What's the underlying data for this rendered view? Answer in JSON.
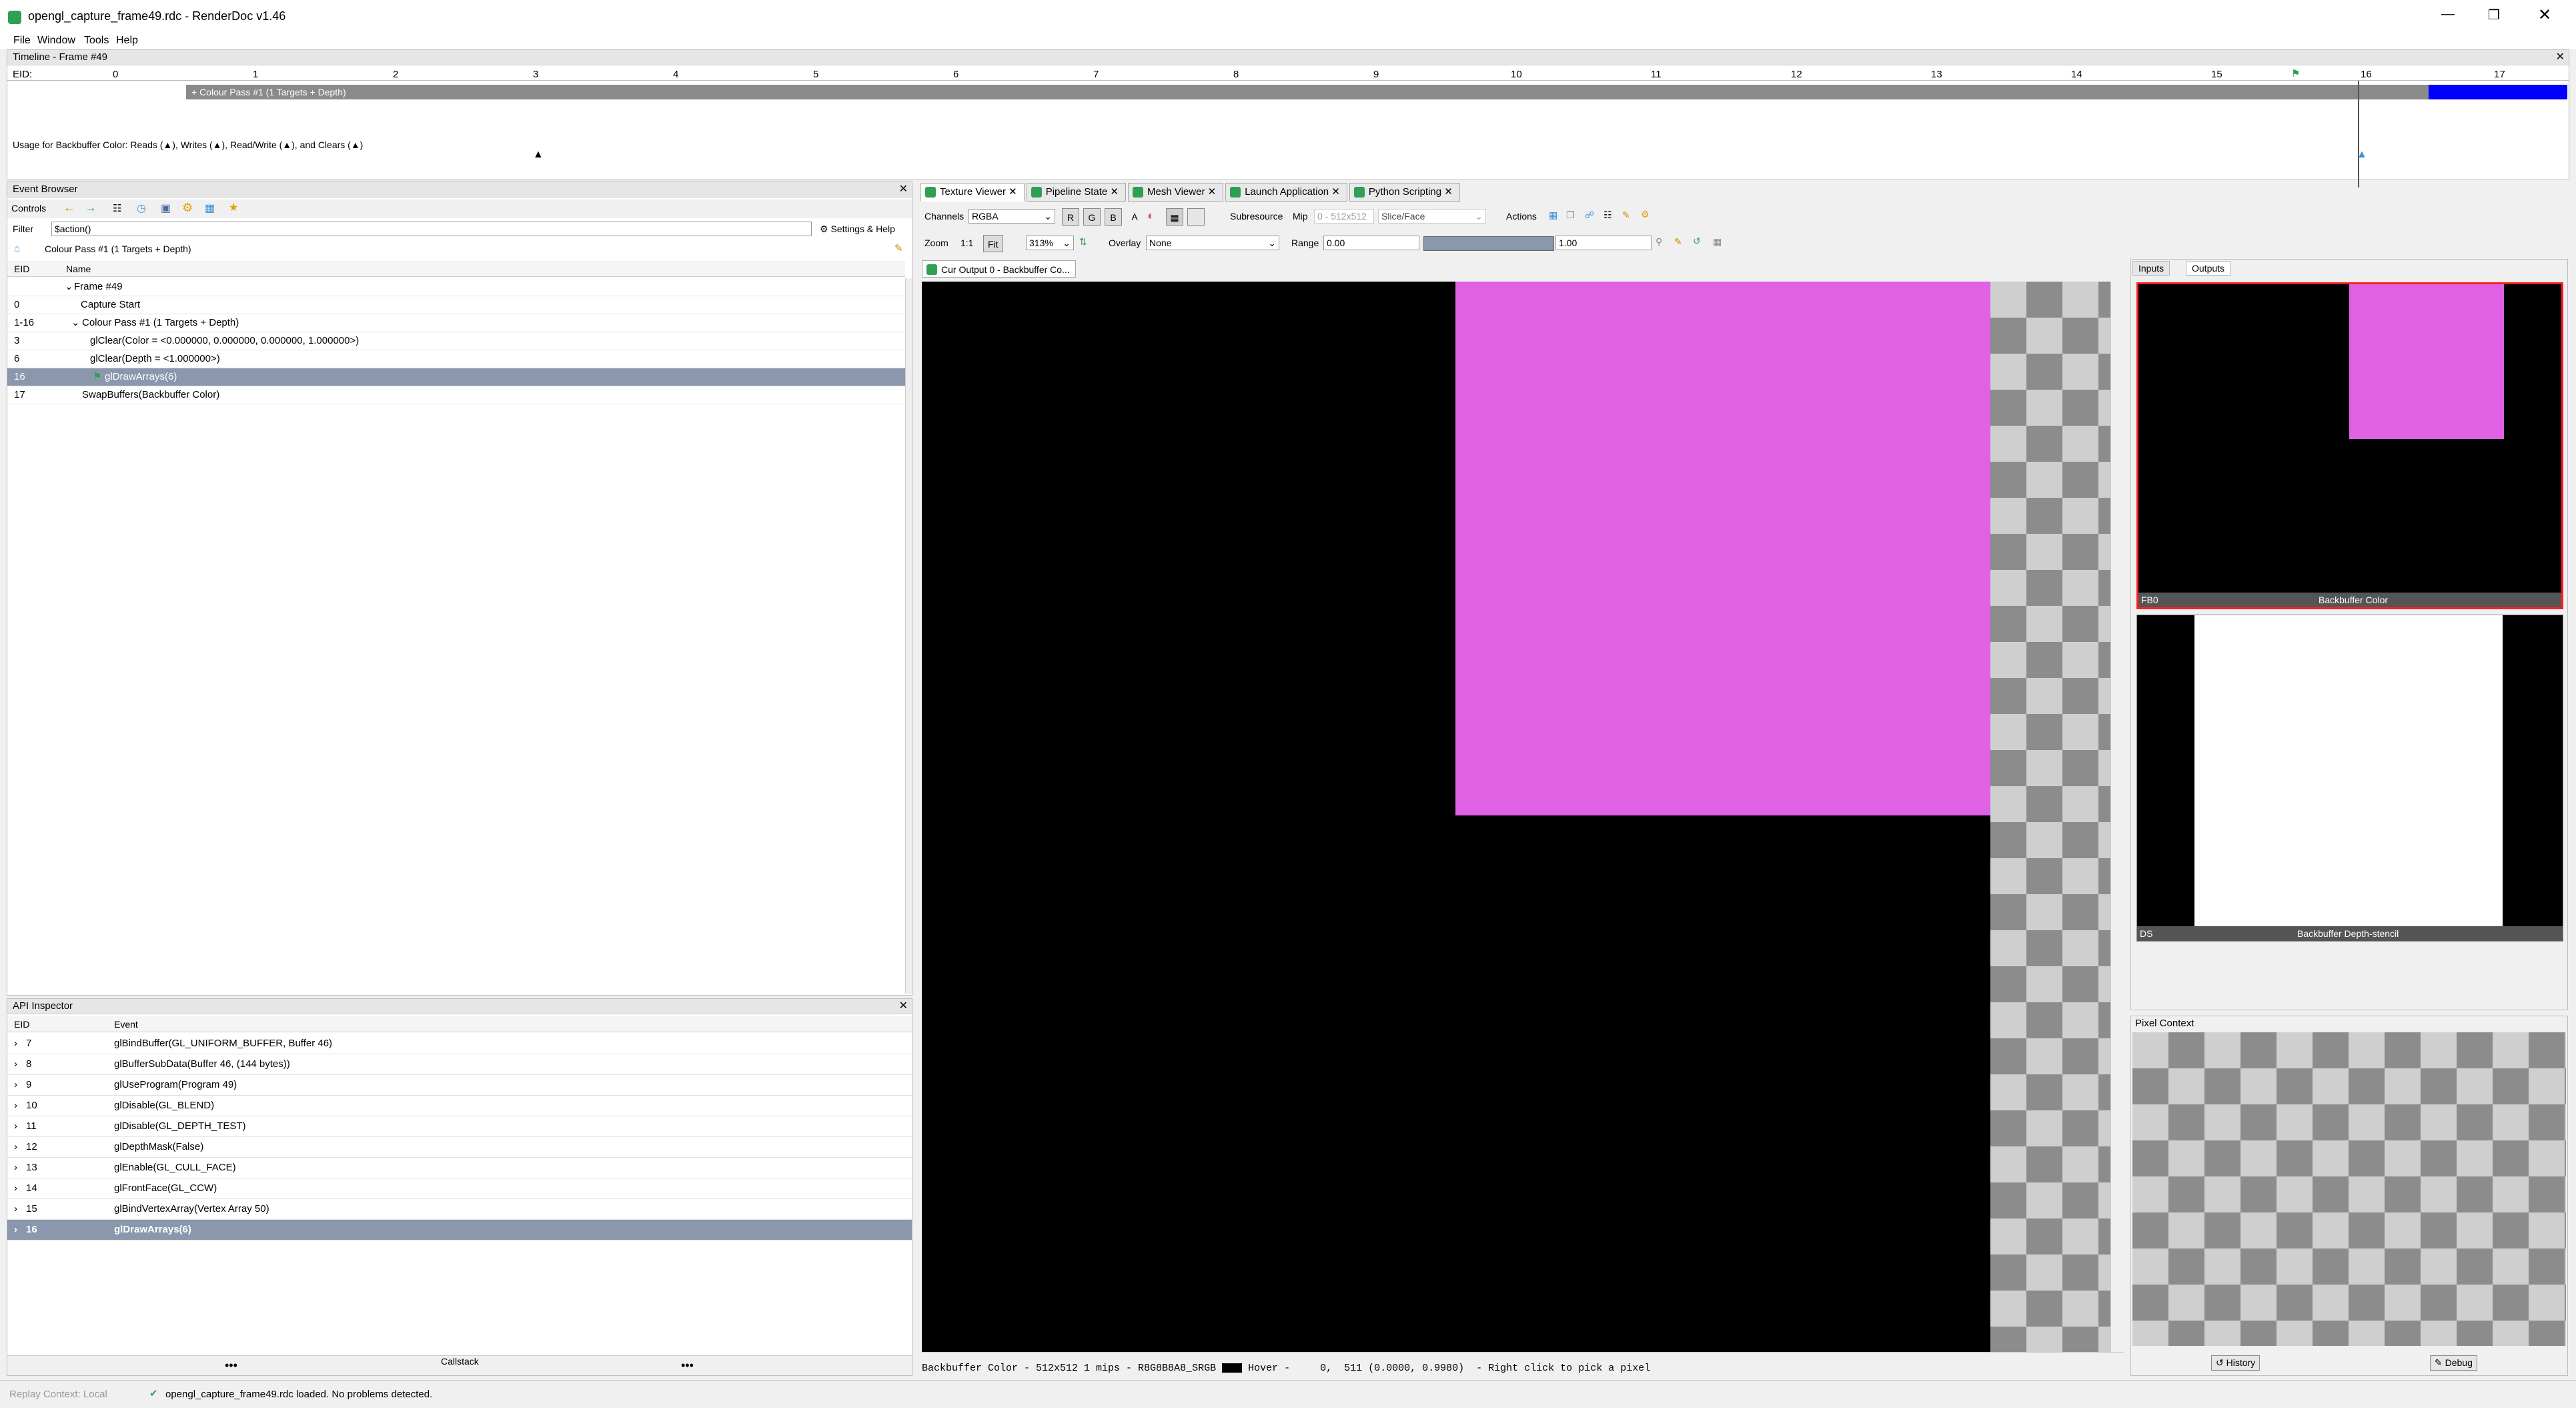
{
  "window": {
    "title": "opengl_capture_frame49.rdc - RenderDoc v1.46"
  },
  "menu": [
    "File",
    "Window",
    "Tools",
    "Help"
  ],
  "timeline": {
    "title": "Timeline - Frame #49",
    "eid_label": "EID:",
    "ticks": [
      "0",
      "1",
      "2",
      "3",
      "4",
      "5",
      "6",
      "7",
      "8",
      "9",
      "10",
      "11",
      "12",
      "13",
      "14",
      "15",
      "16",
      "17"
    ],
    "pass_label": "+ Colour Pass #1 (1 Targets + Depth)",
    "usage_text": "Usage for Backbuffer Color: Reads (▲), Writes (▲), Read/Write (▲), and Clears (▲)"
  },
  "event_browser": {
    "title": "Event Browser",
    "controls_label": "Controls",
    "filter_label": "Filter",
    "filter_value": "$action()",
    "settings_label": "Settings & Help",
    "breadcrumb": "Colour Pass #1 (1 Targets + Depth)",
    "col_eid": "EID",
    "col_name": "Name",
    "rows": [
      {
        "eid": "",
        "name": "Frame #49"
      },
      {
        "eid": "0",
        "name": "Capture Start"
      },
      {
        "eid": "1-16",
        "name": "Colour Pass #1 (1 Targets + Depth)"
      },
      {
        "eid": "3",
        "name": "glClear(Color = <0.000000, 0.000000, 0.000000, 1.000000>)"
      },
      {
        "eid": "6",
        "name": "glClear(Depth = <1.000000>)"
      },
      {
        "eid": "16",
        "name": "glDrawArrays(6)"
      },
      {
        "eid": "17",
        "name": "SwapBuffers(Backbuffer Color)"
      }
    ]
  },
  "api_inspector": {
    "title": "API Inspector",
    "col_eid": "EID",
    "col_event": "Event",
    "rows": [
      {
        "eid": "7",
        "event": "glBindBuffer(GL_UNIFORM_BUFFER, Buffer 46)"
      },
      {
        "eid": "8",
        "event": "glBufferSubData(Buffer 46, (144 bytes))"
      },
      {
        "eid": "9",
        "event": "glUseProgram(Program 49)"
      },
      {
        "eid": "10",
        "event": "glDisable(GL_BLEND)"
      },
      {
        "eid": "11",
        "event": "glDisable(GL_DEPTH_TEST)"
      },
      {
        "eid": "12",
        "event": "glDepthMask(False)"
      },
      {
        "eid": "13",
        "event": "glEnable(GL_CULL_FACE)"
      },
      {
        "eid": "14",
        "event": "glFrontFace(GL_CCW)"
      },
      {
        "eid": "15",
        "event": "glBindVertexArray(Vertex Array 50)"
      },
      {
        "eid": "16",
        "event": "glDrawArrays(6)"
      }
    ],
    "callstack_label": "Callstack"
  },
  "tabs": [
    "Texture Viewer",
    "Pipeline State",
    "Mesh Viewer",
    "Launch Application",
    "Python Scripting"
  ],
  "texture_viewer": {
    "channels_label": "Channels",
    "channels_value": "RGBA",
    "channel_buttons": [
      "R",
      "G",
      "B",
      "A"
    ],
    "subresource_label": "Subresource",
    "mip_label": "Mip",
    "mip_value": "0 - 512x512",
    "slice_label": "Slice/Face",
    "actions_label": "Actions",
    "zoom_label": "Zoom",
    "zoom_1to1": "1:1",
    "fit_label": "Fit",
    "zoom_value": "313%",
    "overlay_label": "Overlay",
    "overlay_value": "None",
    "range_label": "Range",
    "range_min": "0.00",
    "range_max": "1.00",
    "output_tab": "Cur Output 0 - Backbuffer Co...",
    "status_text": "Backbuffer Color - 512x512 1 mips - R8G8B8A8_SRGB",
    "hover_text": "Hover -     0,  511 (0.0000, 0.9980)  - Right click to pick a pixel"
  },
  "thumbnails": {
    "tab_inputs": "Inputs",
    "tab_outputs": "Outputs",
    "items": [
      {
        "slot": "FB0",
        "label": "Backbuffer Color"
      },
      {
        "slot": "DS",
        "label": "Backbuffer Depth-stencil"
      }
    ]
  },
  "pixel_context": {
    "title": "Pixel Context",
    "history_label": "History",
    "debug_label": "Debug"
  },
  "status_bar": {
    "context": "Replay Context: Local",
    "message": "opengl_capture_frame49.rdc loaded. No problems detected."
  },
  "colors": {
    "magenta": "#de62e3",
    "selection": "#8a97ad",
    "accent_green": "#2e9f53",
    "timeline_marker": "#0000ff",
    "thumb_border": "#ff2020"
  }
}
